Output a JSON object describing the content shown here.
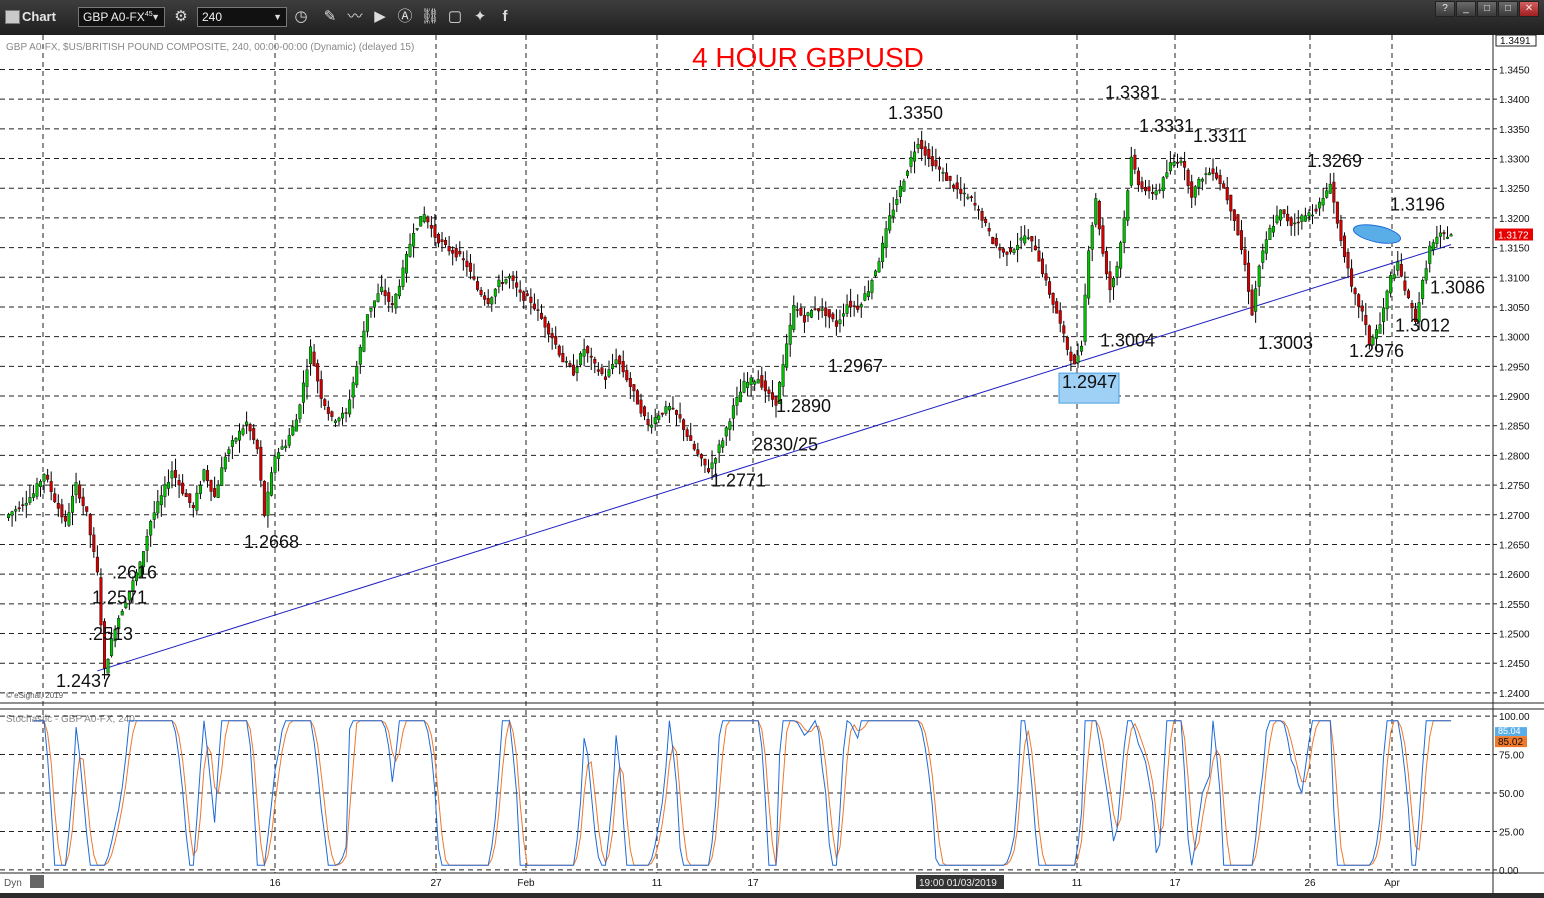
{
  "window": {
    "title": "Chart",
    "help": "?",
    "min": "_",
    "restore": "□",
    "max": "□",
    "close": "✕"
  },
  "toolbar": {
    "symbol": "GBP A0-FX",
    "symbol_sup": "45",
    "interval": "240",
    "icons": [
      "settings-icon",
      "clock-icon",
      "pencil-icon",
      "line-chart-icon",
      "play-icon",
      "alert-icon",
      "link-icon",
      "comment-icon",
      "twitter-icon",
      "facebook-icon"
    ]
  },
  "chart": {
    "info_line": "GBP A0-FX, $US/BRITISH POUND COMPOSITE, 240, 00:00-00:00 (Dynamic) (delayed 15)",
    "title": "4 HOUR GBPUSD",
    "copyright": "© eSignal, 2019",
    "top_price_badge": "1.3491",
    "last_price": "1.3172",
    "last_price_value": 1.3172,
    "date_cursor": "19:00 01/03/2019",
    "dyn_label": "Dyn",
    "colors": {
      "up": "#00c000",
      "down": "#d00000",
      "title": "#ff0000",
      "trend": "#2020c0",
      "price_badge": "#e60000",
      "stoch_k": "#1e6bd8",
      "stoch_d": "#f0782a"
    }
  },
  "chart_data": {
    "type": "candlestick",
    "title": "4 HOUR GBPUSD",
    "subtitle": "GBP A0-FX, $US/BRITISH POUND COMPOSITE, 240",
    "y_ticks": [
      "1.3450",
      "1.3400",
      "1.3350",
      "1.3300",
      "1.3250",
      "1.3200",
      "1.3150",
      "1.3100",
      "1.3050",
      "1.3000",
      "1.2950",
      "1.2900",
      "1.2850",
      "1.2800",
      "1.2750",
      "1.2700",
      "1.2650",
      "1.2600",
      "1.2550",
      "1.2500",
      "1.2450",
      "1.2400"
    ],
    "ylim": [
      1.2383,
      1.3508
    ],
    "x_ticks": [
      "16",
      "27",
      "Feb",
      "11",
      "17",
      "11",
      "17",
      "26",
      "Apr"
    ],
    "price_path": [
      [
        0,
        1.2695
      ],
      [
        8,
        1.2735
      ],
      [
        11,
        1.277
      ],
      [
        14,
        1.2725
      ],
      [
        17,
        1.2685
      ],
      [
        20,
        1.275
      ],
      [
        23,
        1.27
      ],
      [
        26,
        1.26
      ],
      [
        28,
        1.2437
      ],
      [
        31,
        1.2513
      ],
      [
        35,
        1.2571
      ],
      [
        38,
        1.2616
      ],
      [
        41,
        1.269
      ],
      [
        44,
        1.273
      ],
      [
        47,
        1.2775
      ],
      [
        50,
        1.274
      ],
      [
        53,
        1.271
      ],
      [
        56,
        1.2775
      ],
      [
        59,
        1.273
      ],
      [
        62,
        1.28
      ],
      [
        65,
        1.283
      ],
      [
        68,
        1.2855
      ],
      [
        71,
        1.281
      ],
      [
        73,
        1.27
      ],
      [
        76,
        1.28
      ],
      [
        79,
        1.282
      ],
      [
        82,
        1.286
      ],
      [
        86,
        1.298
      ],
      [
        89,
        1.29
      ],
      [
        92,
        1.286
      ],
      [
        96,
        1.287
      ],
      [
        99,
        1.295
      ],
      [
        102,
        1.304
      ],
      [
        106,
        1.308
      ],
      [
        109,
        1.305
      ],
      [
        112,
        1.311
      ],
      [
        115,
        1.318
      ],
      [
        118,
        1.3205
      ],
      [
        121,
        1.317
      ],
      [
        124,
        1.315
      ],
      [
        127,
        1.314
      ],
      [
        130,
        1.312
      ],
      [
        133,
        1.308
      ],
      [
        136,
        1.306
      ],
      [
        139,
        1.309
      ],
      [
        142,
        1.31
      ],
      [
        145,
        1.307
      ],
      [
        148,
        1.306
      ],
      [
        151,
        1.303
      ],
      [
        154,
        1.3
      ],
      [
        157,
        1.296
      ],
      [
        160,
        1.294
      ],
      [
        163,
        1.298
      ],
      [
        166,
        1.295
      ],
      [
        169,
        1.293
      ],
      [
        172,
        1.2965
      ],
      [
        175,
        1.293
      ],
      [
        178,
        1.289
      ],
      [
        181,
        1.285
      ],
      [
        184,
        1.287
      ],
      [
        187,
        1.288
      ],
      [
        190,
        1.286
      ],
      [
        193,
        1.282
      ],
      [
        196,
        1.279
      ],
      [
        198,
        1.2775
      ],
      [
        200,
        1.28
      ],
      [
        202,
        1.2828
      ],
      [
        205,
        1.288
      ],
      [
        208,
        1.292
      ],
      [
        212,
        1.293
      ],
      [
        215,
        1.29
      ],
      [
        217,
        1.289
      ],
      [
        219,
        1.295
      ],
      [
        222,
        1.305
      ],
      [
        225,
        1.303
      ],
      [
        228,
        1.305
      ],
      [
        231,
        1.304
      ],
      [
        234,
        1.302
      ],
      [
        237,
        1.3055
      ],
      [
        240,
        1.305
      ],
      [
        243,
        1.308
      ],
      [
        246,
        1.313
      ],
      [
        249,
        1.32
      ],
      [
        252,
        1.325
      ],
      [
        255,
        1.33
      ],
      [
        257,
        1.333
      ],
      [
        260,
        1.33
      ],
      [
        263,
        1.328
      ],
      [
        266,
        1.326
      ],
      [
        269,
        1.324
      ],
      [
        272,
        1.323
      ],
      [
        275,
        1.32
      ],
      [
        278,
        1.316
      ],
      [
        281,
        1.314
      ],
      [
        284,
        1.315
      ],
      [
        287,
        1.317
      ],
      [
        290,
        1.315
      ],
      [
        293,
        1.309
      ],
      [
        296,
        1.304
      ],
      [
        299,
        1.298
      ],
      [
        301,
        1.295
      ],
      [
        303,
        1.299
      ],
      [
        305,
        1.315
      ],
      [
        307,
        1.323
      ],
      [
        309,
        1.314
      ],
      [
        311,
        1.308
      ],
      [
        313,
        1.312
      ],
      [
        315,
        1.32
      ],
      [
        317,
        1.33
      ],
      [
        319,
        1.326
      ],
      [
        322,
        1.324
      ],
      [
        325,
        1.325
      ],
      [
        328,
        1.329
      ],
      [
        331,
        1.33
      ],
      [
        334,
        1.324
      ],
      [
        337,
        1.327
      ],
      [
        340,
        1.328
      ],
      [
        343,
        1.325
      ],
      [
        346,
        1.32
      ],
      [
        349,
        1.312
      ],
      [
        351,
        1.304
      ],
      [
        353,
        1.312
      ],
      [
        356,
        1.318
      ],
      [
        359,
        1.321
      ],
      [
        362,
        1.319
      ],
      [
        365,
        1.32
      ],
      [
        368,
        1.321
      ],
      [
        371,
        1.323
      ],
      [
        373,
        1.3262
      ],
      [
        375,
        1.319
      ],
      [
        377,
        1.314
      ],
      [
        379,
        1.308
      ],
      [
        382,
        1.304
      ],
      [
        384,
        1.299
      ],
      [
        387,
        1.302
      ],
      [
        390,
        1.31
      ],
      [
        392,
        1.312
      ],
      [
        395,
        1.306
      ],
      [
        397,
        1.303
      ],
      [
        399,
        1.309
      ],
      [
        401,
        1.315
      ],
      [
        404,
        1.317
      ],
      [
        407,
        1.3172
      ]
    ],
    "annotations": [
      {
        "text": "1.2437",
        "value": 1.2437
      },
      {
        "text": ".2513",
        "value": 1.2513
      },
      {
        "text": "1.2571",
        "value": 1.2571
      },
      {
        "text": ".2616",
        "value": 1.2616
      },
      {
        "text": "1.2668",
        "value": 1.2668
      },
      {
        "text": "1.2771",
        "value": 1.2771
      },
      {
        "text": "2830/25",
        "value": 1.2825
      },
      {
        "text": "1.2890",
        "value": 1.289
      },
      {
        "text": "1.2967",
        "value": 1.2967
      },
      {
        "text": "1.3350",
        "value": 1.335
      },
      {
        "text": "1.2947",
        "value": 1.2947
      },
      {
        "text": "1.3004",
        "value": 1.3004
      },
      {
        "text": "1.3381",
        "value": 1.3381
      },
      {
        "text": "1.3331",
        "value": 1.3331
      },
      {
        "text": "1.3311",
        "value": 1.3311
      },
      {
        "text": "1.3003",
        "value": 1.3003
      },
      {
        "text": "1.3269",
        "value": 1.3269
      },
      {
        "text": "1.2976",
        "value": 1.2976
      },
      {
        "text": "1.3196",
        "value": 1.3196
      },
      {
        "text": "1.3012",
        "value": 1.3012
      },
      {
        "text": "1.3086",
        "value": 1.3086
      }
    ],
    "trendline": [
      {
        "x": 26,
        "y": 1.2437
      },
      {
        "x": 407,
        "y": 1.3155
      }
    ],
    "stochastic": {
      "name": "Stochastic - GBP A0-FX, 240",
      "k_value": "85.02",
      "d_value": "85.04",
      "y_ticks": [
        "100.00",
        "75.00",
        "50.00",
        "25.00",
        "0.00"
      ],
      "ylim": [
        -2,
        102
      ]
    }
  }
}
